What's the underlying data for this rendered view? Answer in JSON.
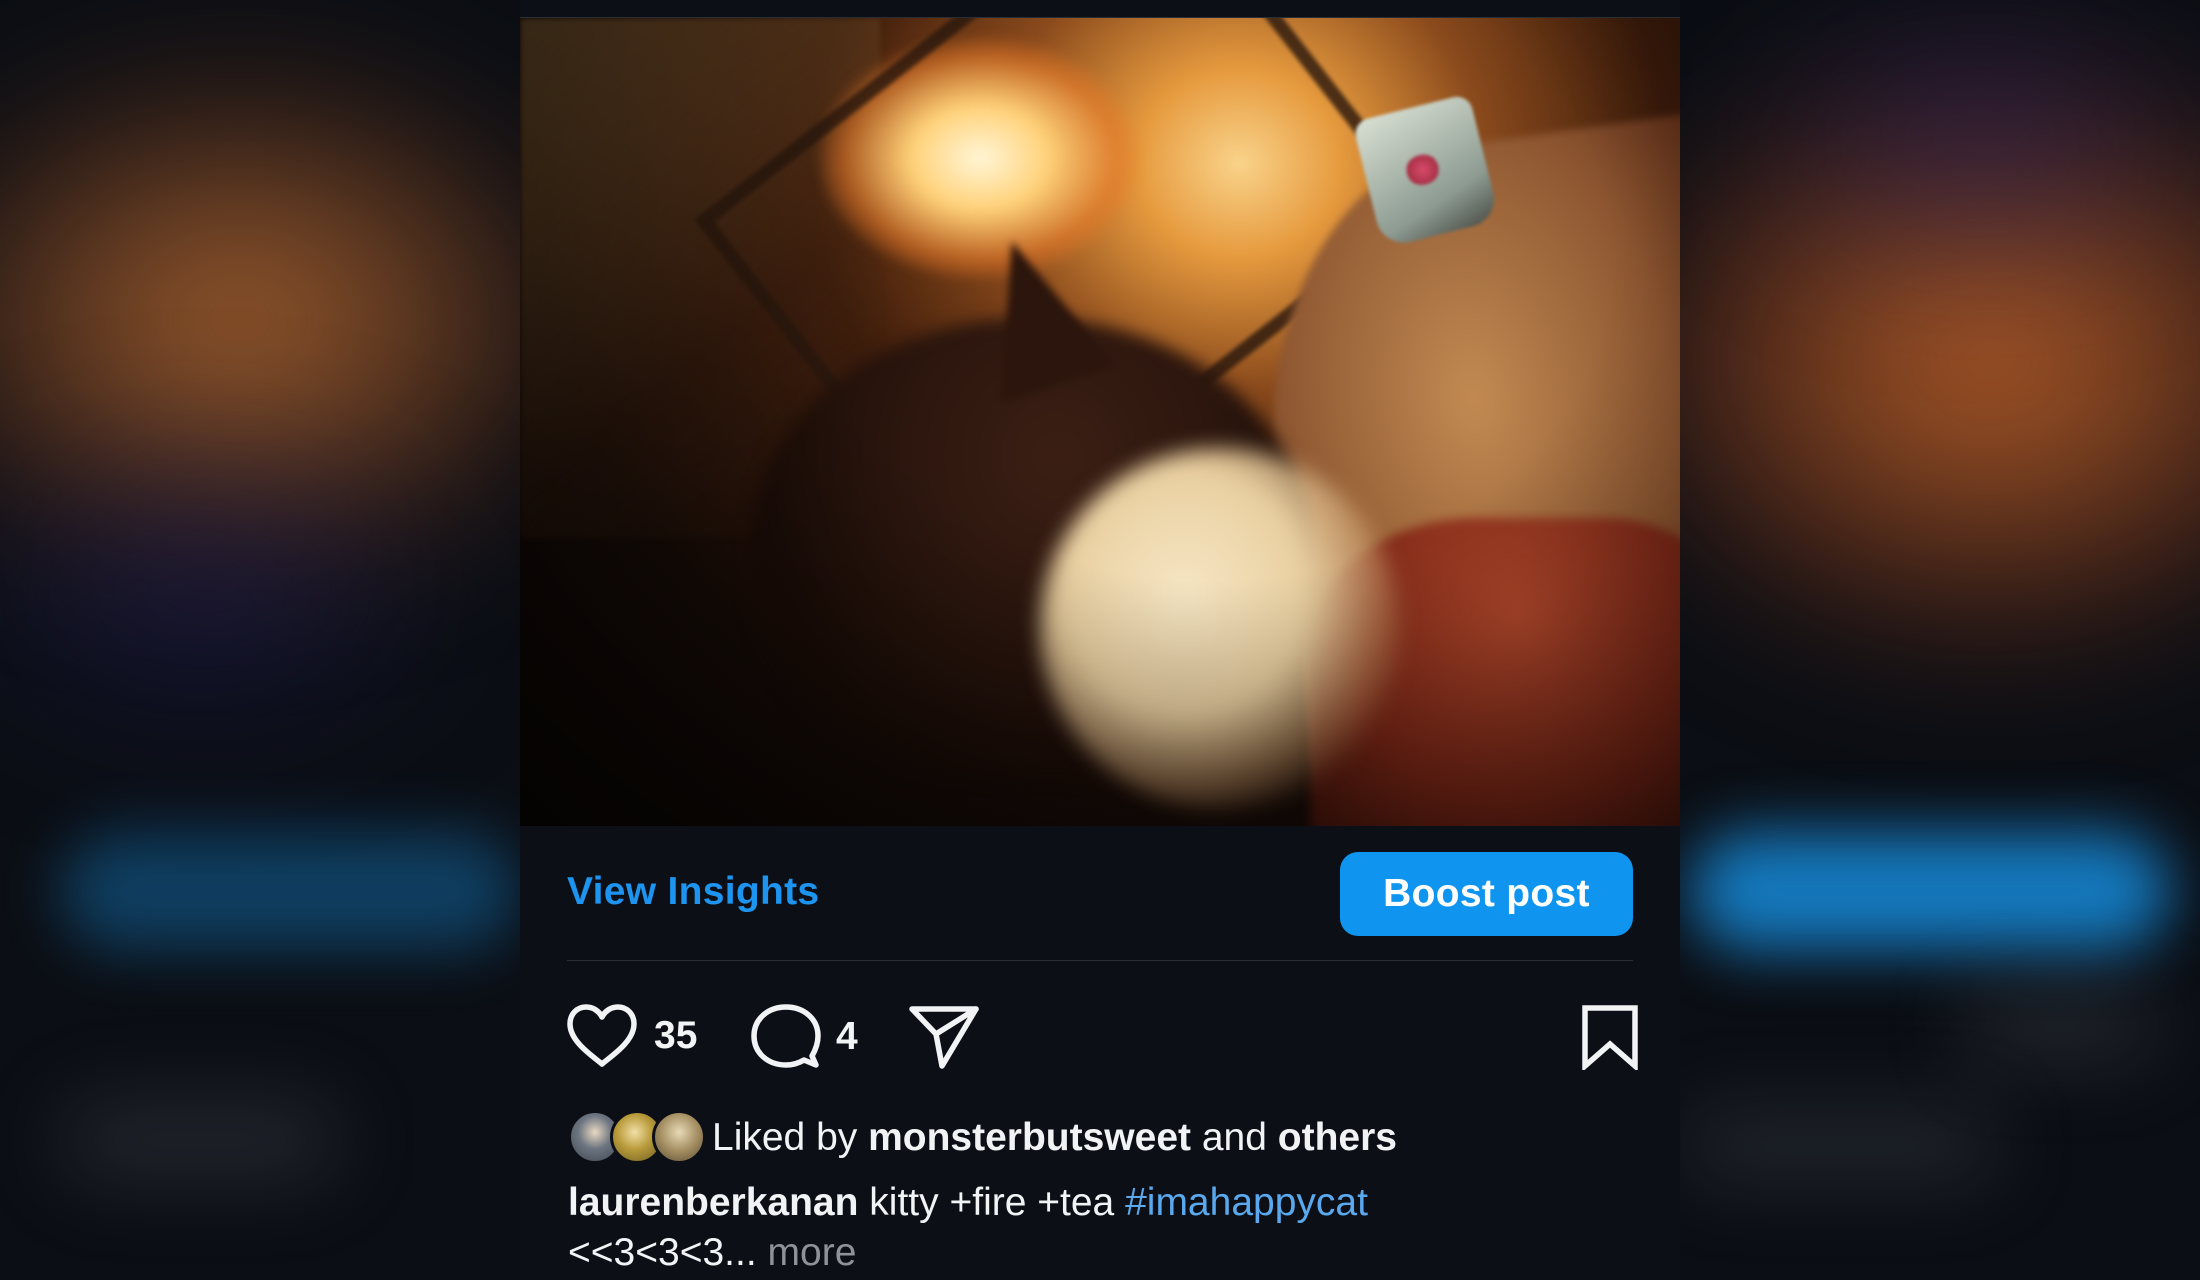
{
  "post": {
    "insights_label": "View Insights",
    "boost_label": "Boost post",
    "likes_count": "35",
    "comments_count": "4",
    "liked_by_prefix": "Liked by",
    "liked_by_user": "monsterbutsweet",
    "liked_by_and": "and",
    "liked_by_others": "others",
    "caption_user": "laurenberkanan",
    "caption_text": "kitty +fire +tea",
    "caption_hashtag": "#imahappycat",
    "caption_line2": "<<3<3<3...",
    "more_label": "more"
  },
  "icons": {
    "like": "heart-icon",
    "comment": "comment-bubble-icon",
    "share": "paper-plane-icon",
    "save": "bookmark-icon"
  },
  "colors": {
    "accent": "#1d94f0",
    "button": "#0f95f0",
    "hashtag": "#5aa9ef",
    "muted": "#8e939b",
    "card_bg": "#0c1016"
  }
}
